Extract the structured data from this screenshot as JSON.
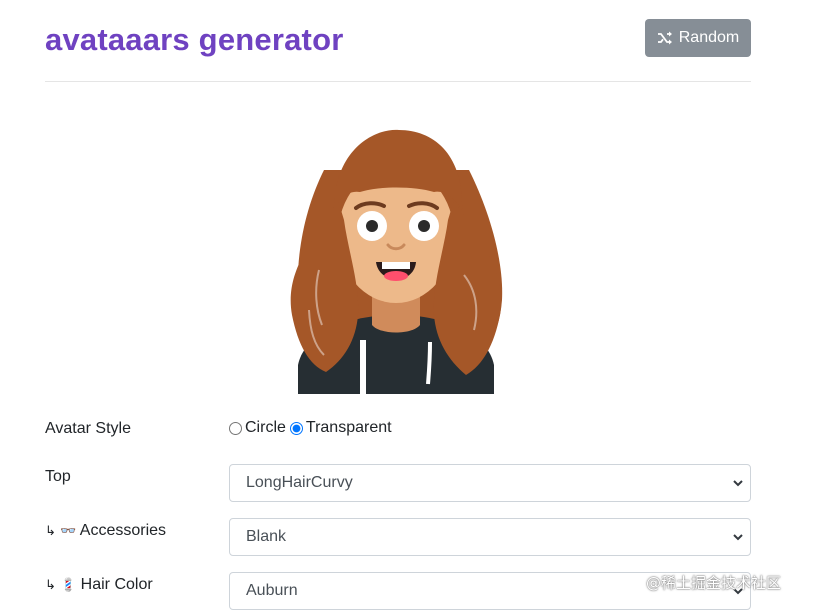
{
  "header": {
    "title": "avataaars generator",
    "random_label": "Random"
  },
  "avatar": {
    "hair_color": "#A55728",
    "skin_color": "#EDB98A",
    "clothes_color": "#262E33"
  },
  "form": {
    "avatar_style": {
      "label": "Avatar Style",
      "options": [
        "Circle",
        "Transparent"
      ],
      "selected": "Transparent"
    },
    "top": {
      "label": "Top",
      "value": "LongHairCurvy"
    },
    "accessories": {
      "prefix": "↳ 👓",
      "label": "Accessories",
      "value": "Blank"
    },
    "hair_color": {
      "prefix": "↳ 💈",
      "label": "Hair Color",
      "value": "Auburn"
    }
  },
  "watermark": "@稀土掘金技术社区",
  "colors": {
    "title": "#6f42c1",
    "button_bg": "#868e96"
  },
  "icons": {
    "random": "shuffle-icon",
    "select": "chevron-down-icon"
  }
}
